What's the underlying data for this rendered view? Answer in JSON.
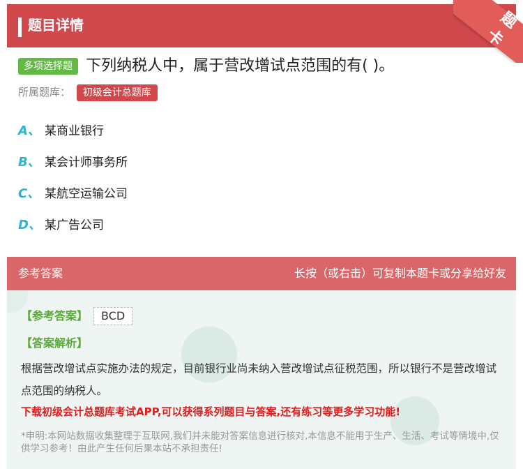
{
  "header": {
    "title": "题目详情",
    "corner_badge": "题卡"
  },
  "question": {
    "type_label": "多项选择题",
    "text": "下列纳税人中，属于营改增试点范围的有( )。",
    "bank_label": "所属题库：",
    "bank_name": "初级会计总题库"
  },
  "options": [
    {
      "letter": "A、",
      "text": "某商业银行"
    },
    {
      "letter": "B、",
      "text": "某会计师事务所"
    },
    {
      "letter": "C、",
      "text": "某航空运输公司"
    },
    {
      "letter": "D、",
      "text": "某广告公司"
    }
  ],
  "answer_panel": {
    "title": "参考答案",
    "hint": "长按（或右击）可复制本题卡或分享给好友",
    "ref_label": "【参考答案】",
    "ref_value": "BCD",
    "analysis_label": "【答案解析】",
    "analysis_text": "根据营改增试点实施办法的规定，目前银行业尚未纳入营改增试点征税范围，所以银行不是营改增试点范围的纳税人。",
    "promo": "下载初级会计总题库考试APP,可以获得系列题目与答案,还有练习等更多学习功能!",
    "disclaimer": "*申明:本网站数据收集整理于互联网,我们并未能对答案信息进行核对,本信息不能用于生产、生活、考试等情境中,仅供学习参考！由此产生任何后果本站不承担责任!"
  },
  "colors": {
    "header": "#d0484b",
    "answer_header": "#d9676a",
    "type_badge": "#64b845",
    "option_letter": "#2db4d3",
    "promo": "#e21b1b"
  }
}
